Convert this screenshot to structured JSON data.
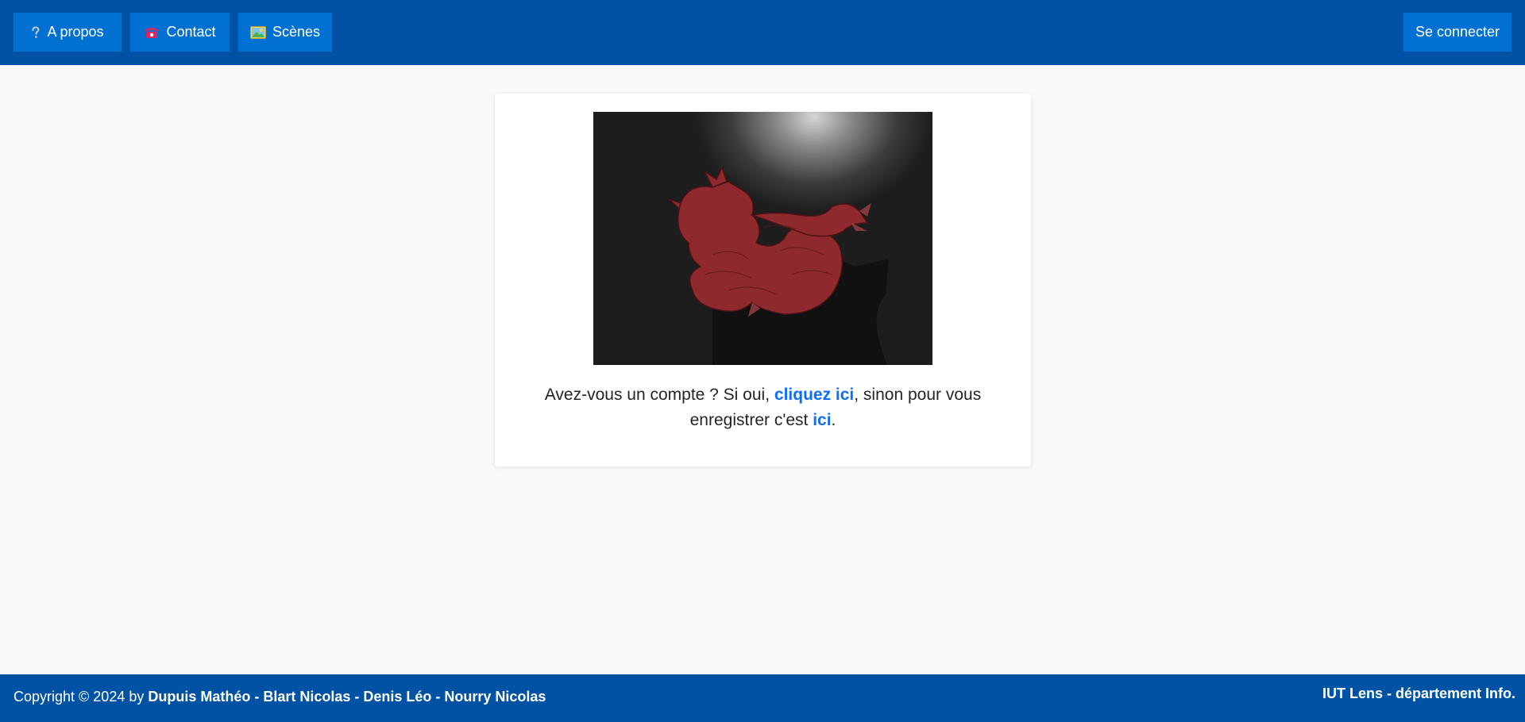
{
  "nav": {
    "about_label": "A propos",
    "contact_label": "Contact",
    "scenes_label": "Scènes",
    "login_label": "Se connecter"
  },
  "icons": {
    "about": "question-mark-icon",
    "contact": "telephone-icon",
    "scenes": "landscape-picture-icon"
  },
  "card": {
    "text_before": "Avez-vous un compte ? Si oui, ",
    "login_link": "cliquez ici",
    "text_middle": ", sinon pour vous enregistrer c'est ",
    "register_link": "ici",
    "text_after": "."
  },
  "footer": {
    "copyright_prefix": "Copyright © 2024 by ",
    "authors": "Dupuis Mathéo - Blart Nicolas - Denis Léo - Nourry Nicolas",
    "institution": "IUT Lens - département Info."
  },
  "colors": {
    "navbar": "#0052a5",
    "button": "#0070d2",
    "link": "#0d6efd",
    "dragon": "#8e2a2e"
  }
}
